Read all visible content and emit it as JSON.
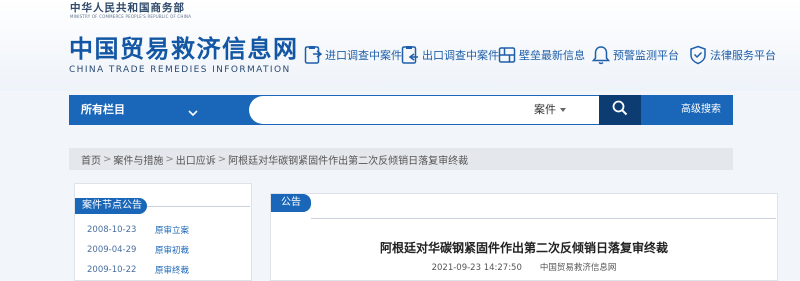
{
  "header": {
    "ministry_cn": "中华人民共和国商务部",
    "ministry_en": "MINISTRY OF COMMERCE PEOPLE'S REPUBLIC OF CHINA",
    "site_title_cn": "中国贸易救济信息网",
    "site_title_en": "CHINA TRADE REMEDIES INFORMATION"
  },
  "top_nav": [
    {
      "label": "进口调查中案件",
      "icon": "import-case-icon"
    },
    {
      "label": "出口调查中案件",
      "icon": "export-case-icon"
    },
    {
      "label": "壁垒最新信息",
      "icon": "barrier-info-icon"
    },
    {
      "label": "预警监测平台",
      "icon": "bell-icon"
    },
    {
      "label": "法律服务平台",
      "icon": "shield-check-icon"
    }
  ],
  "navbar": {
    "all_columns": "所有栏目",
    "search_placeholder": "",
    "search_type": "案件",
    "advanced_search": "高级搜索"
  },
  "breadcrumb": [
    "首页",
    "案件与措施",
    "出口应诉",
    "阿根廷对华碳钢紧固件作出第二次反倾销日落复审终裁"
  ],
  "sidebar": {
    "heading": "案件节点公告",
    "items": [
      {
        "date": "2008-10-23",
        "label": "原审立案"
      },
      {
        "date": "2009-04-29",
        "label": "原审初裁"
      },
      {
        "date": "2009-10-22",
        "label": "原审终裁"
      }
    ]
  },
  "content": {
    "tab_label": "公告",
    "title": "阿根廷对华碳钢紧固件作出第二次反倾销日落复审终裁",
    "timestamp": "2021-09-23 14:27:50",
    "source": "中国贸易救济信息网"
  },
  "colors": {
    "primary_blue": "#1a66b8",
    "dark_blue": "#0c3c72",
    "title_blue": "#1356a3"
  }
}
